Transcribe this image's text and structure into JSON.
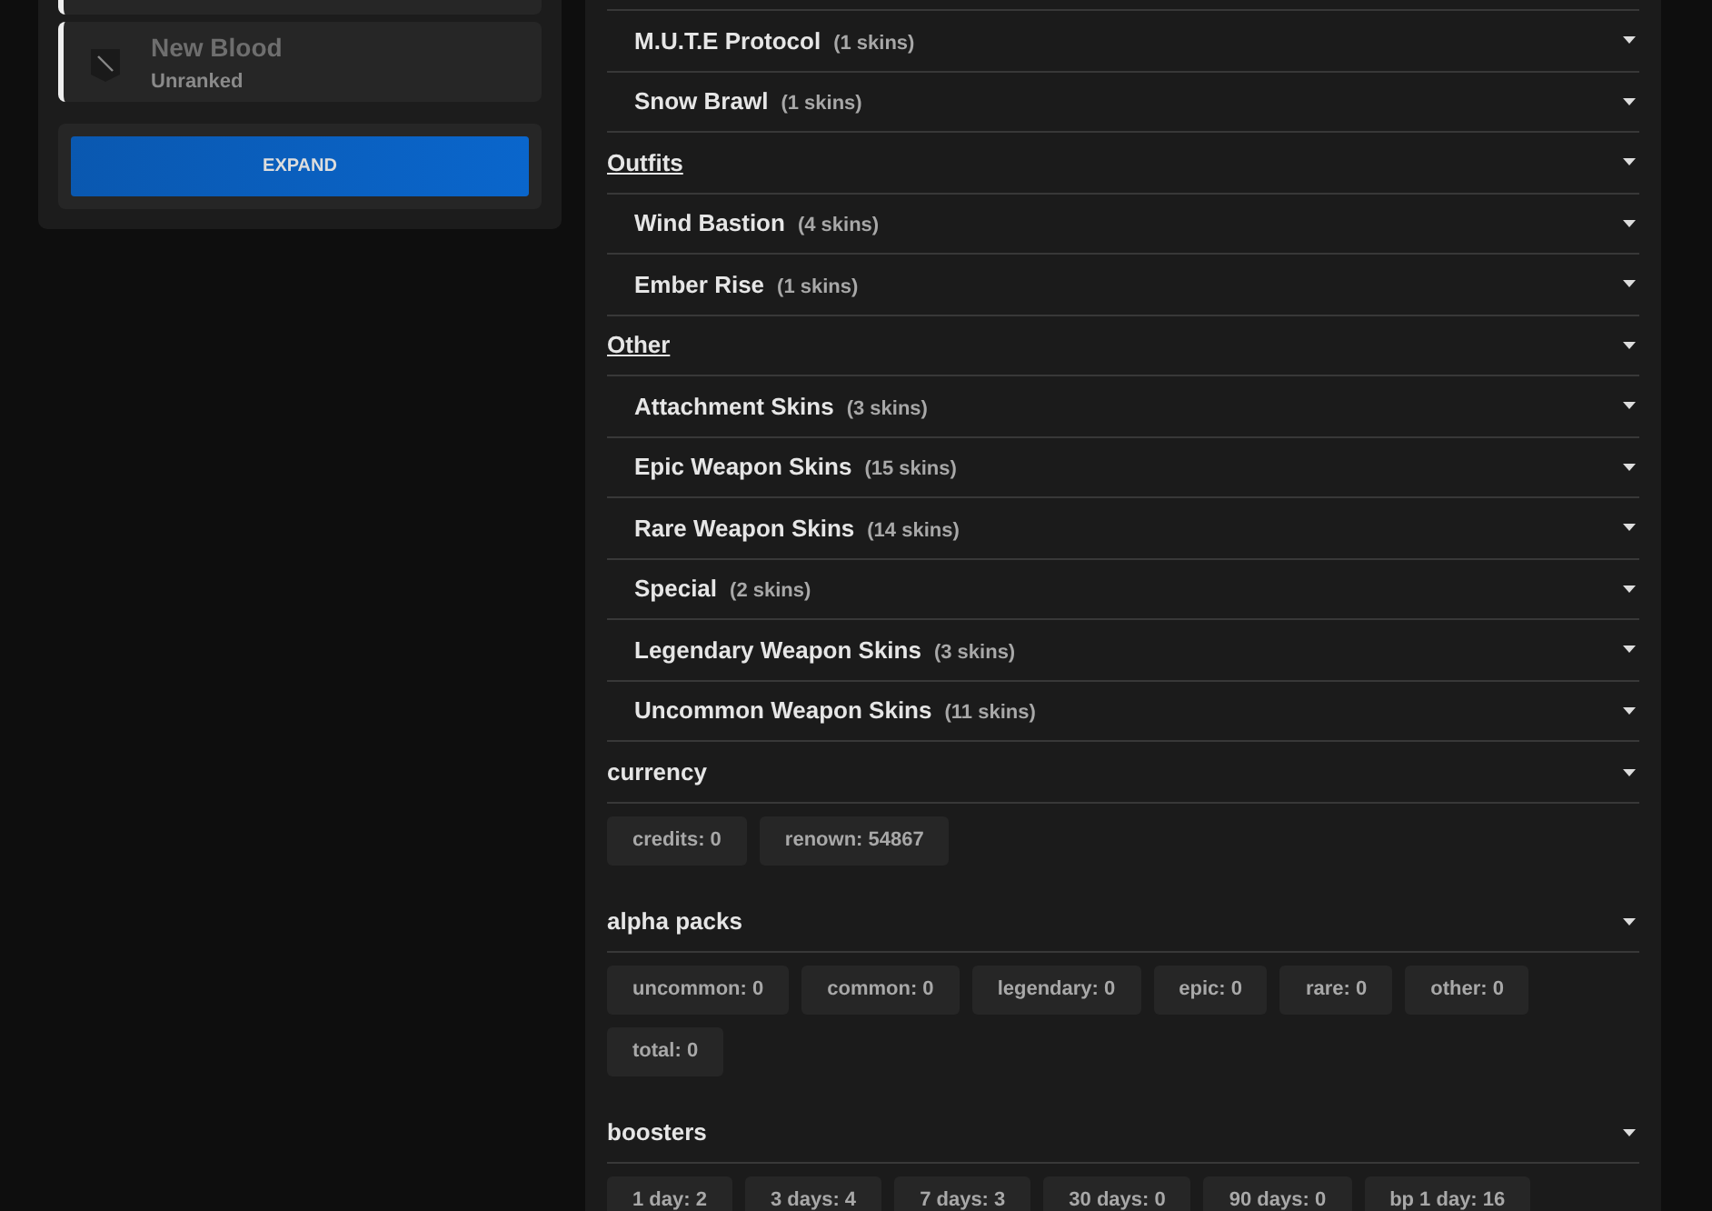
{
  "sidebar": {
    "rank_card": {
      "name": "New Blood",
      "rank": "Unranked"
    },
    "expand_button": "EXPAND"
  },
  "skins": [
    {
      "kind": "subcategory",
      "name": "M.U.T.E Protocol",
      "count": "(1 skins)"
    },
    {
      "kind": "subcategory",
      "name": "Snow Brawl",
      "count": "(1 skins)"
    },
    {
      "kind": "category",
      "name": "Outfits"
    },
    {
      "kind": "subcategory",
      "name": "Wind Bastion",
      "count": "(4 skins)"
    },
    {
      "kind": "subcategory",
      "name": "Ember Rise",
      "count": "(1 skins)"
    },
    {
      "kind": "category",
      "name": "Other"
    },
    {
      "kind": "subcategory",
      "name": "Attachment Skins",
      "count": "(3 skins)"
    },
    {
      "kind": "subcategory",
      "name": "Epic Weapon Skins",
      "count": "(15 skins)"
    },
    {
      "kind": "subcategory",
      "name": "Rare Weapon Skins",
      "count": "(14 skins)"
    },
    {
      "kind": "subcategory",
      "name": "Special",
      "count": "(2 skins)"
    },
    {
      "kind": "subcategory",
      "name": "Legendary Weapon Skins",
      "count": "(3 skins)"
    },
    {
      "kind": "subcategory",
      "name": "Uncommon Weapon Skins",
      "count": "(11 skins)"
    }
  ],
  "sections": [
    {
      "title": "currency",
      "chips": [
        "credits: 0",
        "renown: 54867"
      ]
    },
    {
      "title": "alpha packs",
      "chips": [
        "uncommon: 0",
        "common: 0",
        "legendary: 0",
        "epic: 0",
        "rare: 0",
        "other: 0",
        "total: 0"
      ]
    },
    {
      "title": "boosters",
      "chips": [
        "1 day: 2",
        "3 days: 4",
        "7 days: 3",
        "30 days: 0",
        "90 days: 0",
        "bp 1 day: 16"
      ]
    }
  ]
}
